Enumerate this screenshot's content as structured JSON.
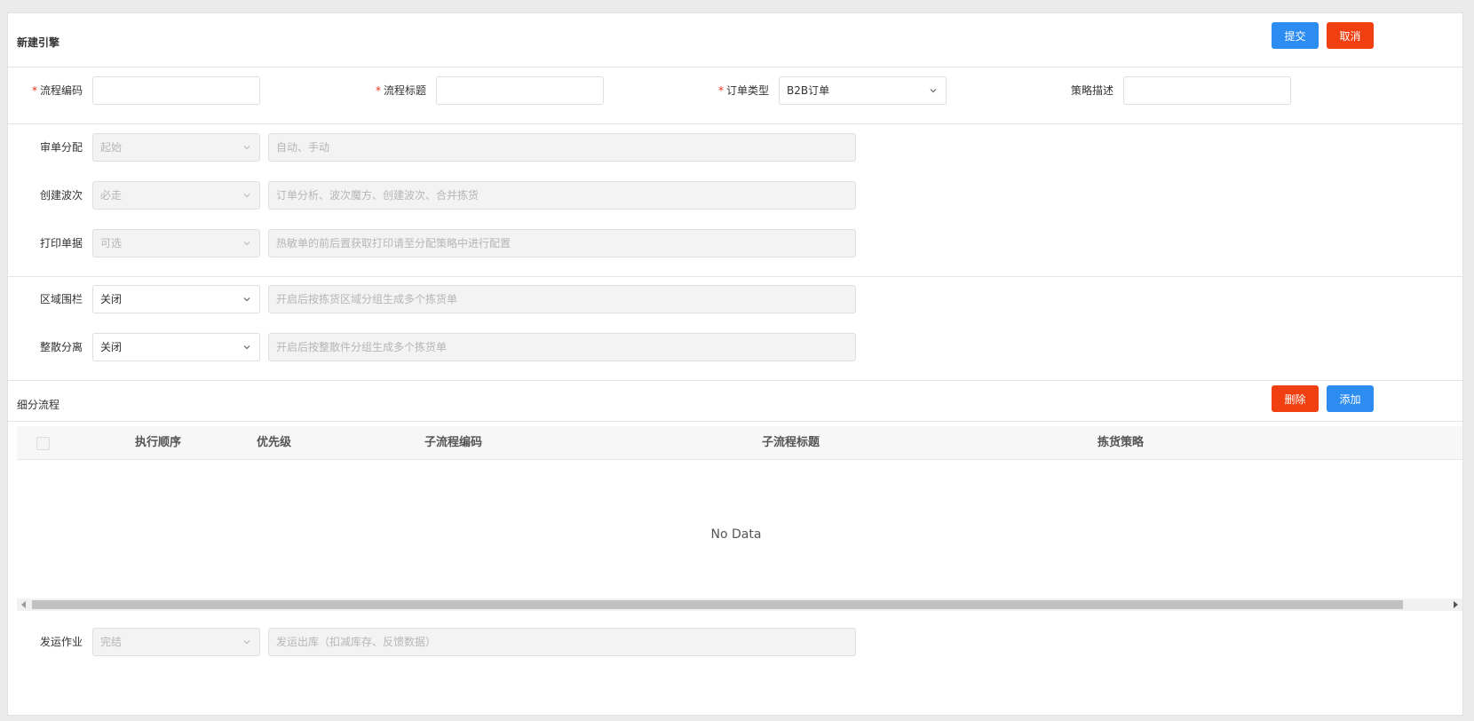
{
  "header": {
    "title": "新建引擎",
    "submit_label": "提交",
    "cancel_label": "取消"
  },
  "top_form": {
    "flow_code_label": "流程编码",
    "flow_title_label": "流程标题",
    "order_type_label": "订单类型",
    "order_type_value": "B2B订单",
    "strategy_desc_label": "策略描述"
  },
  "steps": [
    {
      "label": "审单分配",
      "select": "起始",
      "desc": "自动、手动"
    },
    {
      "label": "创建波次",
      "select": "必走",
      "desc": "订单分析、波次魔方、创建波次、合并拣货"
    },
    {
      "label": "打印单据",
      "select": "可选",
      "desc": "热敏单的前后置获取打印请至分配策略中进行配置"
    }
  ],
  "options": [
    {
      "label": "区域围栏",
      "select": "关闭",
      "desc": "开启后按拣货区域分组生成多个拣货单"
    },
    {
      "label": "整散分离",
      "select": "关闭",
      "desc": "开启后按整散件分组生成多个拣货单"
    }
  ],
  "subflow": {
    "title": "细分流程",
    "delete_label": "删除",
    "add_label": "添加",
    "columns": [
      "执行顺序",
      "优先级",
      "子流程编码",
      "子流程标题",
      "拣货策略"
    ],
    "empty_text": "No Data"
  },
  "shipping": {
    "label": "发运作业",
    "select": "完结",
    "desc": "发运出库（扣减库存、反馈数据）"
  },
  "colors": {
    "primary": "#2d8cf0",
    "danger": "#f04012",
    "required": "#e8331b"
  }
}
